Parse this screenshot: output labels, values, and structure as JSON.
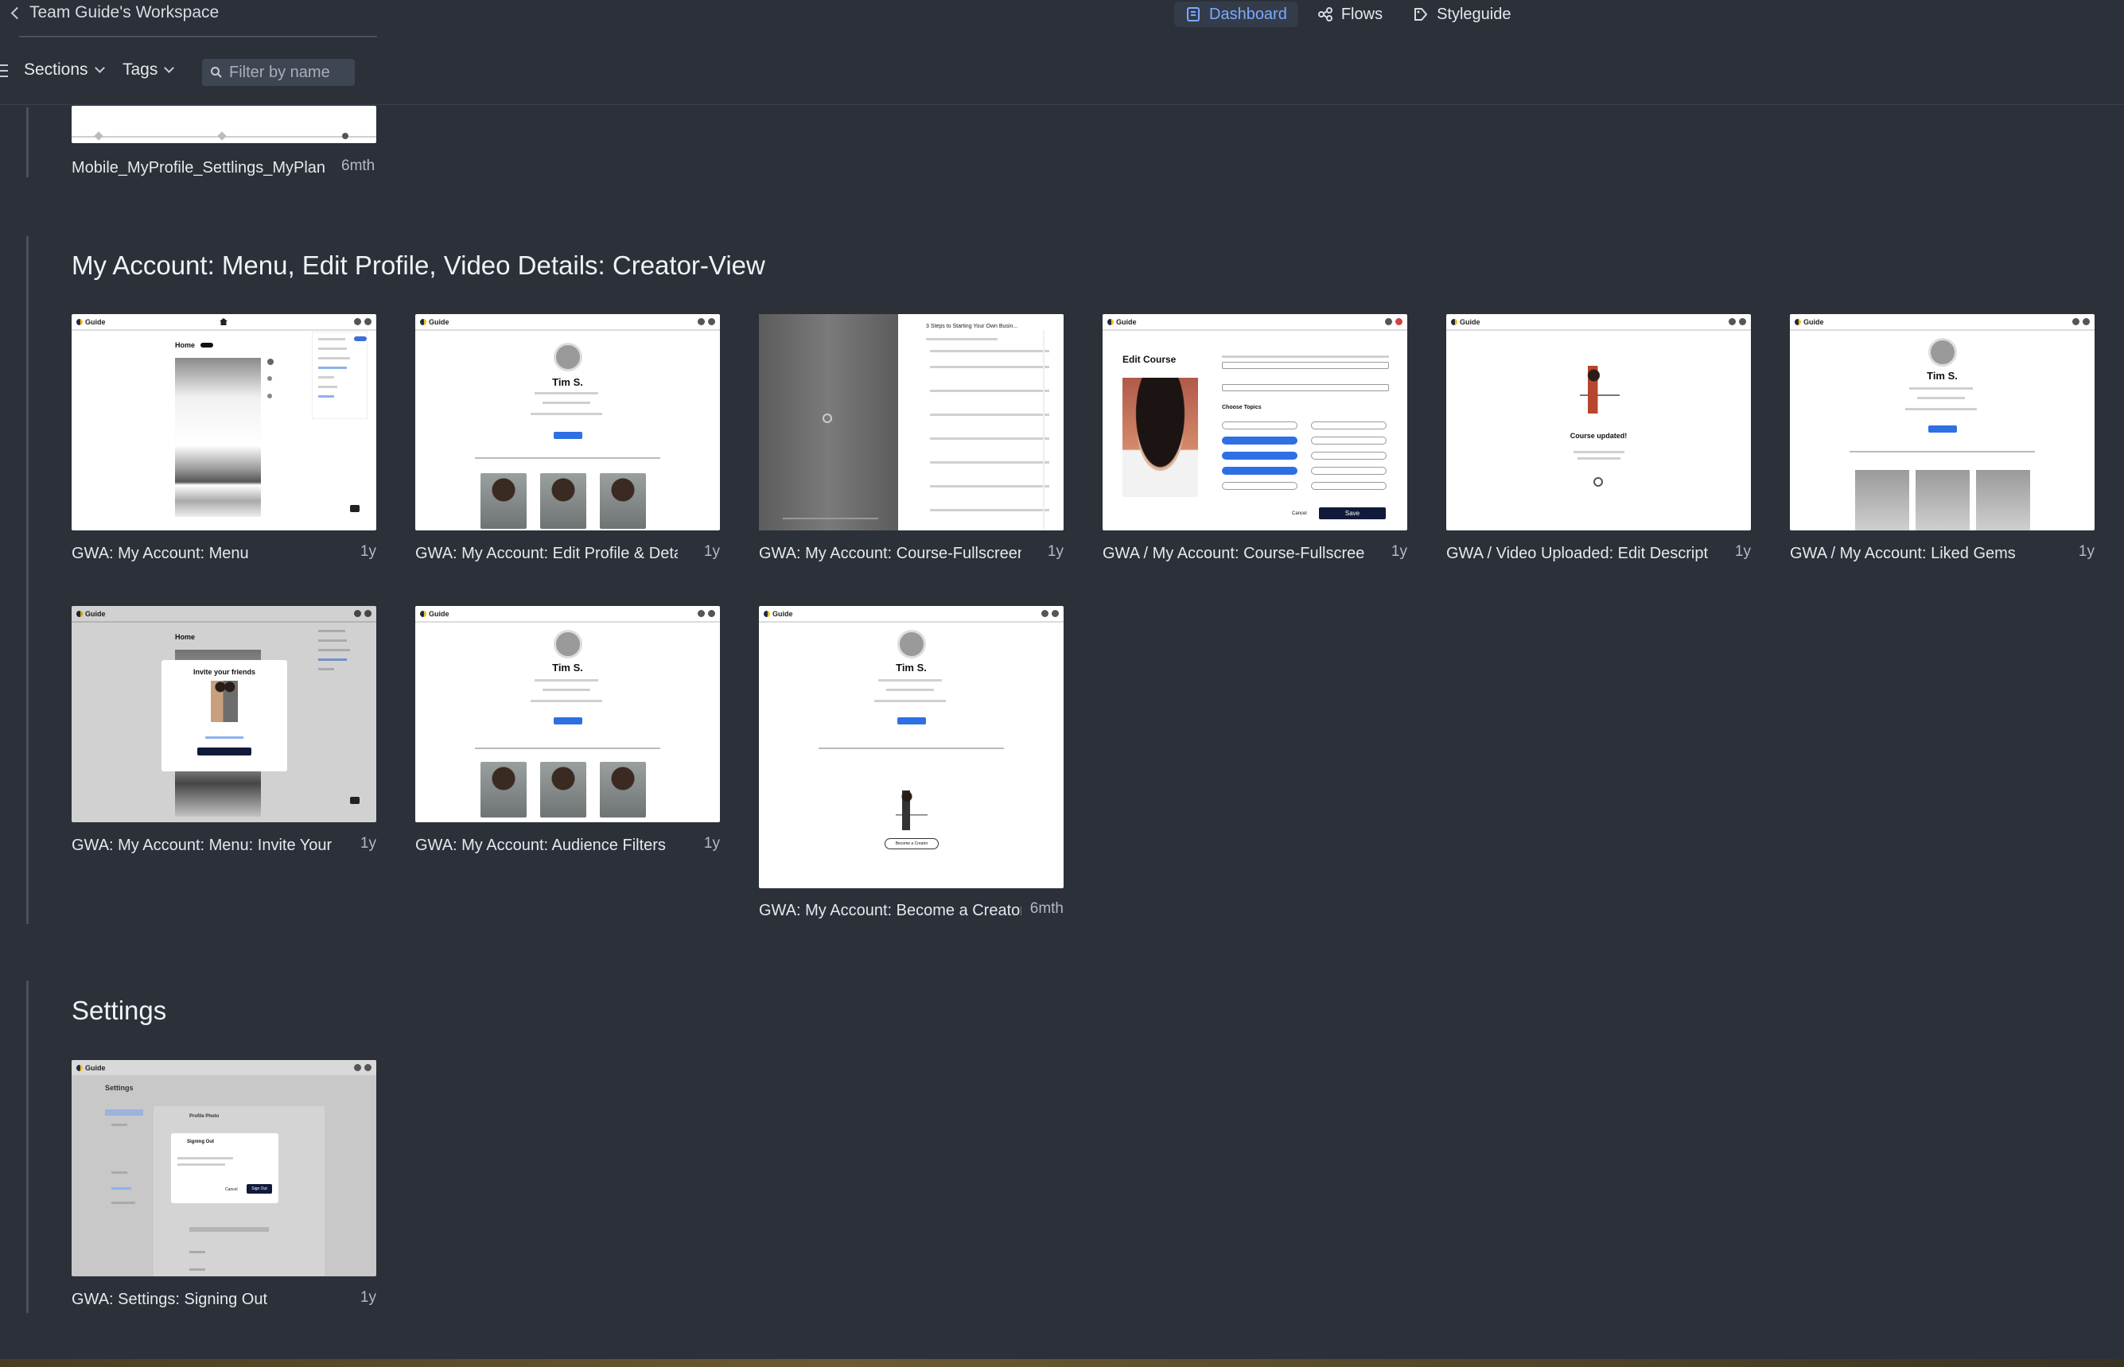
{
  "topbar": {
    "workspace": "Team Guide's Workspace",
    "tabs": [
      {
        "label": "Dashboard",
        "active": true
      },
      {
        "label": "Flows",
        "active": false
      },
      {
        "label": "Styleguide",
        "active": false
      }
    ]
  },
  "filterbar": {
    "sections_label": "Sections",
    "tags_label": "Tags",
    "search_placeholder": "Filter by name"
  },
  "colors": {
    "background": "#2b3039",
    "accent": "#7ba9ff",
    "active_tab_bg": "#353c49"
  },
  "prev_section": {
    "card": {
      "label": "Mobile_MyProfile_Settlings_MyPlan",
      "age": "6mth"
    }
  },
  "sections": [
    {
      "title": "My Account: Menu, Edit Profile, Video Details: Creator-View",
      "cards": [
        {
          "label": "GWA: My Account: Menu",
          "age": "1y"
        },
        {
          "label": "GWA: My Account: Edit Profile & Details",
          "age": "1y"
        },
        {
          "label": "GWA: My Account: Course-Fullscreen: ",
          "age": "1y"
        },
        {
          "label": "GWA /  My Account: Course-Fullscreen",
          "age": "1y"
        },
        {
          "label": "GWA /  Video Uploaded: Edit Description",
          "age": "1y"
        },
        {
          "label": "GWA / My Account: Liked Gems",
          "age": "1y"
        },
        {
          "label": "GWA: My Account: Menu: Invite Your Friends",
          "age": "1y"
        },
        {
          "label": "GWA: My Account: Audience Filters",
          "age": "1y"
        },
        {
          "label": "GWA: My Account: Become a Creator",
          "age": "6mth"
        }
      ]
    },
    {
      "title": "Settings",
      "cards": [
        {
          "label": "GWA: Settings: Signing Out",
          "age": "1y"
        }
      ]
    }
  ],
  "thumb_text": {
    "logo": "Guide",
    "home": "Home",
    "tim": "Tim S.",
    "edit_course": "Edit Course",
    "choose_topics": "Choose Topics",
    "save": "Save",
    "cancel": "Cancel",
    "course_updated": "Course updated!",
    "invite_friends": "Invite your friends",
    "settings": "Settings",
    "profile_photo": "Profile Photo",
    "signing_out": "Signing Out",
    "sign_out": "Sign Out",
    "become_creator": "Become a Creator",
    "course_title": "3 Steps to Starting Your Own Busin..."
  }
}
